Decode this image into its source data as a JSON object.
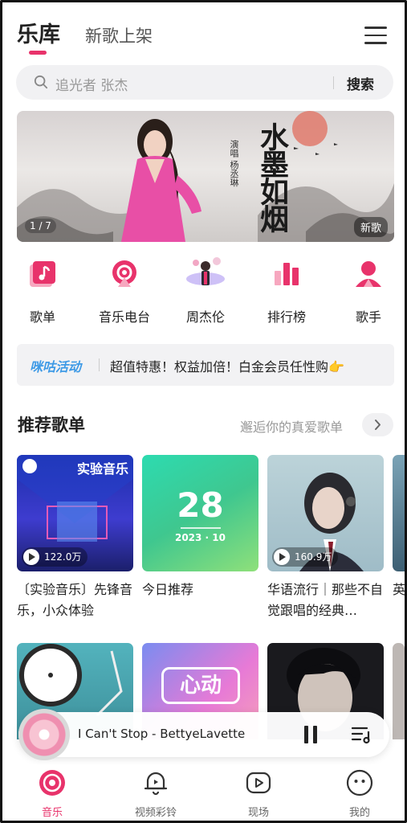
{
  "header": {
    "tab_main": "乐库",
    "tab_sub": "新歌上架"
  },
  "search": {
    "placeholder": "追光者   张杰",
    "button": "搜索"
  },
  "banner": {
    "counter": "1 / 7",
    "tag": "新歌",
    "title": "水墨如烟",
    "artist": "演唱 杨丞琳"
  },
  "quick_nav": [
    {
      "label": "歌单",
      "icon": "playlist-icon"
    },
    {
      "label": "音乐电台",
      "icon": "radio-icon"
    },
    {
      "label": "周杰伦",
      "icon": "artist-avatar-icon"
    },
    {
      "label": "排行榜",
      "icon": "chart-bars-icon"
    },
    {
      "label": "歌手",
      "icon": "singer-icon"
    }
  ],
  "activity": {
    "tag": "咪咕活动",
    "text": "超值特惠！权益加倍！白金会员任性购👉"
  },
  "recommend": {
    "title": "推荐歌单",
    "subtitle": "邂逅你的真爱歌单",
    "cards": [
      {
        "title": "〔实验音乐〕先锋音乐，小众体验",
        "plays": "122.0万",
        "cover_text": "实验音乐"
      },
      {
        "title": "今日推荐",
        "plays": "",
        "cover_day": "28",
        "cover_month": "2023 · 10"
      },
      {
        "title": "华语流行｜那些不自觉跟唱的经典…",
        "plays": "160.9万"
      },
      {
        "title": "英梦",
        "plays": ""
      }
    ],
    "row2_cover_text": "心动"
  },
  "player": {
    "track": "I Can't Stop - BettyeLavette"
  },
  "bottom_nav": [
    {
      "label": "音乐",
      "active": true
    },
    {
      "label": "视频彩铃",
      "active": false
    },
    {
      "label": "现场",
      "active": false
    },
    {
      "label": "我的",
      "active": false
    }
  ],
  "colors": {
    "accent": "#e8336b",
    "activity_tag": "#3e9ae6"
  }
}
